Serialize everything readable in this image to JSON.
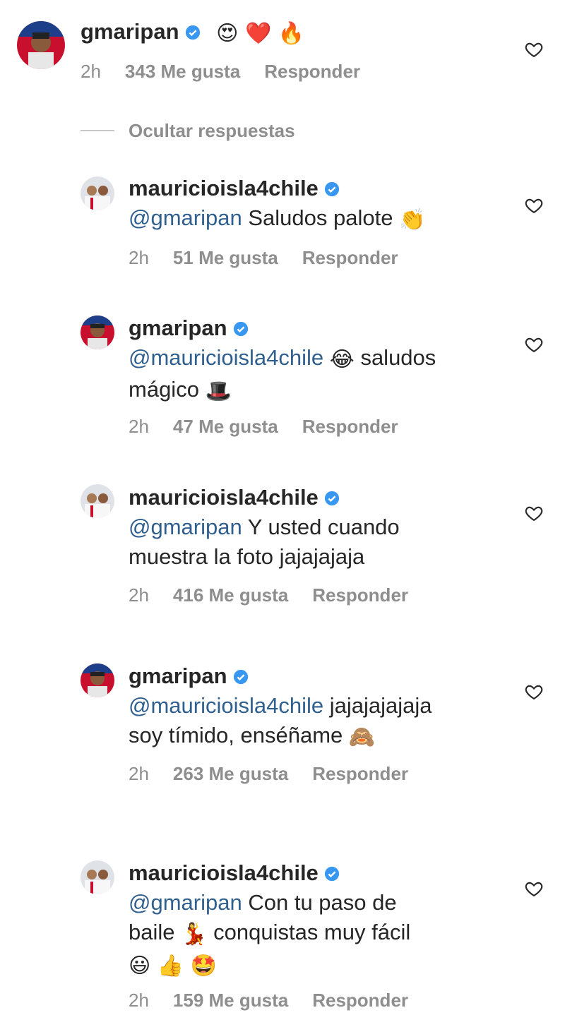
{
  "comments": [
    {
      "user": "gmaripan",
      "avatar": "player-red-jersey",
      "lines": [
        {
          "mention": "",
          "text": "",
          "emoji": "😍 ❤️ 🔥"
        }
      ],
      "time": "2h",
      "likes": "343 Me gusta",
      "reply": "Responder"
    },
    {
      "user": "mauricioisla4chile",
      "avatar": "player-white-jersey",
      "lines": [
        {
          "mention": "@gmaripan",
          "text": "Saludos palote",
          "emoji": "👏"
        }
      ],
      "time": "2h",
      "likes": "51 Me gusta",
      "reply": "Responder"
    },
    {
      "user": "gmaripan",
      "avatar": "player-red-jersey",
      "lines": [
        {
          "mention": "@mauricioisla4chile",
          "text": "",
          "emoji": "😂",
          "after": "saludos"
        },
        {
          "mention": "",
          "text": "mágico",
          "emoji": "🎩"
        }
      ],
      "time": "2h",
      "likes": "47 Me gusta",
      "reply": "Responder"
    },
    {
      "user": "mauricioisla4chile",
      "avatar": "player-white-jersey",
      "lines": [
        {
          "mention": "@gmaripan",
          "text": "Y usted cuando",
          "emoji": ""
        },
        {
          "mention": "",
          "text": "muestra la foto jajajajaja",
          "emoji": ""
        }
      ],
      "time": "2h",
      "likes": "416 Me gusta",
      "reply": "Responder"
    },
    {
      "user": "gmaripan",
      "avatar": "player-red-jersey",
      "lines": [
        {
          "mention": "@mauricioisla4chile",
          "text": "jajajajajaja",
          "emoji": ""
        },
        {
          "mention": "",
          "text": "soy tímido, enséñame",
          "emoji": "🙈"
        }
      ],
      "time": "2h",
      "likes": "263 Me gusta",
      "reply": "Responder"
    },
    {
      "user": "mauricioisla4chile",
      "avatar": "player-white-jersey",
      "lines": [
        {
          "mention": "@gmaripan",
          "text": "Con tu paso de",
          "emoji": ""
        },
        {
          "mention": "",
          "text": "baile",
          "emoji": "💃",
          "after": "conquistas muy fácil"
        },
        {
          "mention": "",
          "text": "",
          "emoji": "😃 👍 🤩"
        }
      ],
      "time": "2h",
      "likes": "159 Me gusta",
      "reply": "Responder"
    }
  ],
  "hide_replies": "Ocultar respuestas",
  "colors": {
    "verified": "#3897f0",
    "mention": "#2f5f8f",
    "meta": "#8e8e8e",
    "red_jersey": "#c8102e"
  },
  "icons": {
    "like": "heart-outline-icon",
    "verified": "verified-badge-icon"
  }
}
